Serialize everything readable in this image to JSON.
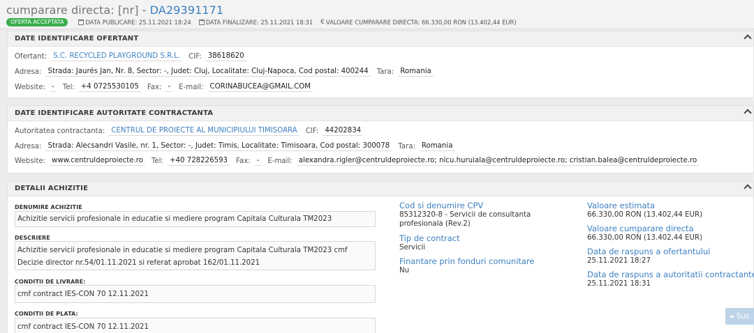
{
  "header": {
    "title_prefix": "cumparare directa: [nr] - ",
    "title_code": "DA29391171",
    "status_badge": "OFERTA ACCEPTATA",
    "data_publicare": "DATA PUBLICARE: 25.11.2021 18:24",
    "data_finalizare": "DATA FINALIZARE: 25.11.2021 18:31",
    "valoare": "VALOARE CUMPARARE DIRECTA: 66.330,00 RON (13.402,44 EUR)"
  },
  "ofertant": {
    "section_title": "DATE IDENTIFICARE OFERTANT",
    "ofertant_label": "Ofertant:",
    "ofertant_value": "S.C. RECYCLED PLAYGROUND S.R.L.",
    "cif_label": "CIF:",
    "cif_value": "38618620",
    "adresa_label": "Adresa:",
    "adresa_value": "Strada: Jaurés Jan, Nr. 8, Sector: -, Judet: Cluj, Localitate: Cluj-Napoca, Cod postal: 400244",
    "tara_label": "Tara:",
    "tara_value": "Romania",
    "website_label": "Website:",
    "website_value": "-",
    "tel_label": "Tel:",
    "tel_value": "+4 0725530105",
    "fax_label": "Fax:",
    "fax_value": "-",
    "email_label": "E-mail:",
    "email_value": "CORINABUCEA@GMAIL.COM"
  },
  "autoritate": {
    "section_title": "DATE IDENTIFICARE AUTORITATE CONTRACTANTA",
    "autoritate_label": "Autoritatea contractanta:",
    "autoritate_value": "CENTRUL DE PROIECTE AL MUNICIPIULUI TIMISOARA",
    "cif_label": "CIF:",
    "cif_value": "44202834",
    "adresa_label": "Adresa:",
    "adresa_value": "Strada: Alecsandri Vasile, nr. 1, Sector: -, Judet: Timis, Localitate: Timisoara, Cod postal: 300078",
    "tara_label": "Tara:",
    "tara_value": "Romania",
    "website_label": "Website:",
    "website_value": "www.centruldeproiecte.ro",
    "tel_label": "Tel:",
    "tel_value": "+40 728226593",
    "fax_label": "Fax:",
    "fax_value": "-",
    "email_label": "E-mail:",
    "email_value": "alexandra.rigler@centruldeproiecte.ro; nicu.huruiala@centruldeproiecte.ro; cristian.balea@centruldeproiecte.ro"
  },
  "achizitie": {
    "section_title": "DETALII ACHIZITIE",
    "denumire_label": "DENUMIRE ACHIZITIE",
    "denumire_value": "Achizitie servicii profesionale in educatie si mediere program Capitala Culturala TM2023",
    "descriere_label": "DESCRIERE",
    "descriere_value": "Achizitie servicii profesionale in educatie si mediere program Capitala Culturala TM2023 cmf Decizie director nr.54/01.11.2021 si referat aprobat 162/01.11.2021",
    "livrare_label": "CONDITII DE LIVRARE:",
    "livrare_value": "cmf contract IES-CON 70 12.11.2021",
    "plata_label": "CONDITII DE PLATA:",
    "plata_value": "cmf contract IES-CON 70 12.11.2021",
    "cpv_title": "Cod si denumire CPV",
    "cpv_value": "85312320-8 - Servicii de consultanta profesionala (Rev.2)",
    "tip_title": "Tip de contract",
    "tip_value": "Servicii",
    "finantare_title": "Finantare prin fonduri comunitare",
    "finantare_value": "Nu",
    "estimata_title": "Valoare estimata",
    "estimata_value": "66.330,00  RON (13.402,44  EUR)",
    "cumparare_title": "Valoare cumparare directa",
    "cumparare_value": "66.330,00  RON (13.402,44  EUR)",
    "raspuns_ofertant_title": "Data de raspuns a ofertantului",
    "raspuns_ofertant_value": "25.11.2021 18:27",
    "raspuns_autoritate_title": "Data de raspuns a autoritatii contractante",
    "raspuns_autoritate_value": "25.11.2021 18:31"
  },
  "scroll_top_label": "Sus"
}
